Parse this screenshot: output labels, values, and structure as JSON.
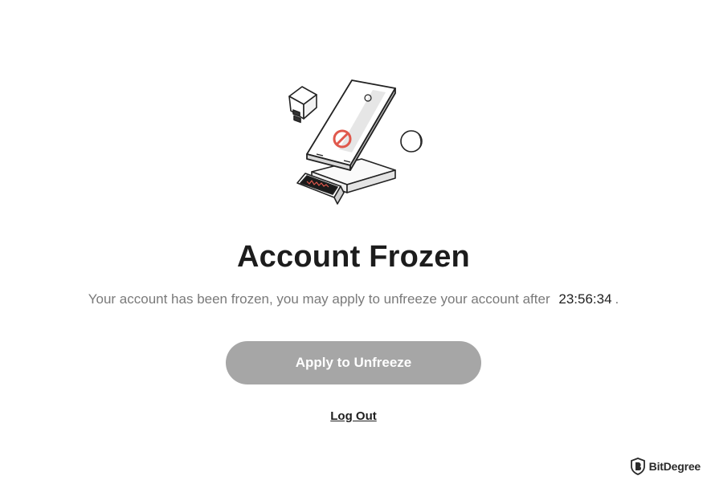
{
  "illustration": {
    "icon": "frozen-phone-illustration",
    "accent_color": "#e0584c"
  },
  "page": {
    "title": "Account Frozen",
    "message_prefix": "Your account has been frozen, you may apply to unfreeze your account after",
    "countdown": "23:56:34",
    "message_suffix": "."
  },
  "actions": {
    "apply_label": "Apply to Unfreeze",
    "apply_color": "#a6a6a6",
    "logout_label": "Log Out"
  },
  "watermark": {
    "text": "BitDegree",
    "icon": "bitdegree-shield-logo"
  }
}
